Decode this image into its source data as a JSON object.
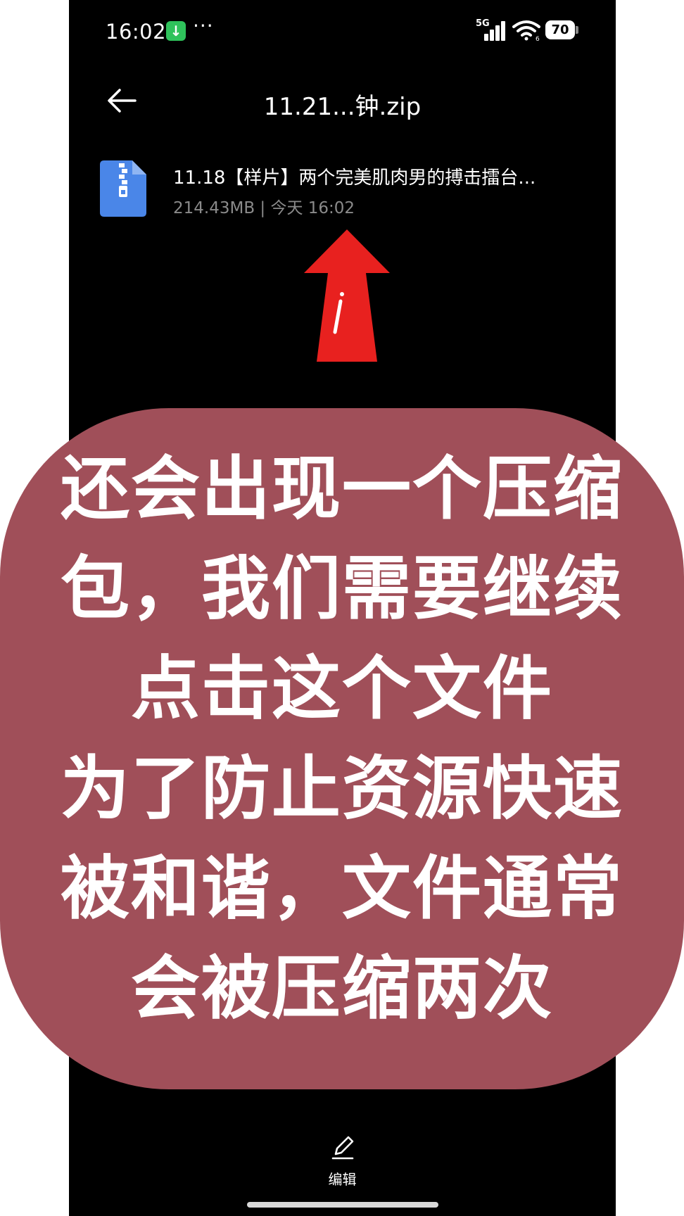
{
  "status_bar": {
    "time": "16:02",
    "download_glyph": "↓",
    "more_dots": "···",
    "network_label": "5G",
    "wifi_sub": "6",
    "battery": "70"
  },
  "nav": {
    "title": "11.21...钟.zip"
  },
  "file": {
    "name": "11.18【样片】两个完美肌肉男的搏击擂台...",
    "meta": "214.43MB | 今天 16:02"
  },
  "overlay": {
    "lines": [
      "还会出现一个压缩",
      "包，我们需要继续",
      "点击这个文件",
      "为了防止资源快速",
      "被和谐，文件通常",
      "会被压缩两次"
    ],
    "background_color": "#a04f59"
  },
  "bottom_bar": {
    "edit_label": "编辑"
  },
  "icons": {
    "back": "back-arrow-icon",
    "zip": "zip-file-icon",
    "edit": "pencil-icon",
    "pointer": "red-arrow-icon"
  },
  "colors": {
    "arrow": "#e8211f",
    "zip_icon": "#4a86e8"
  }
}
